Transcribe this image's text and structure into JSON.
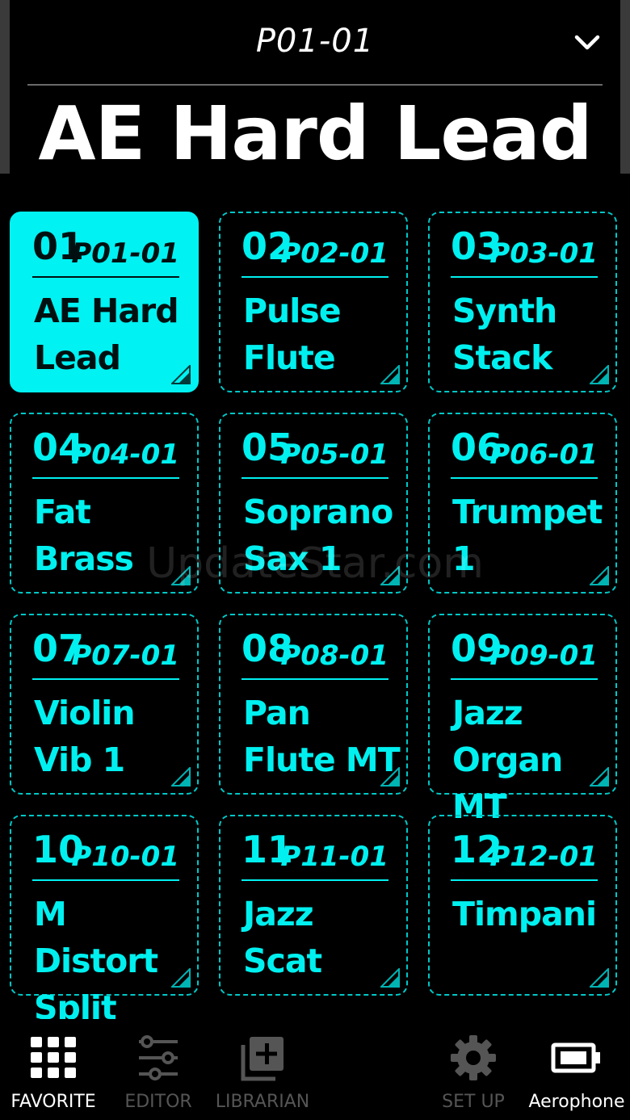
{
  "header": {
    "patch_code": "P01-01",
    "patch_name": "AE Hard Lead"
  },
  "tiles": [
    {
      "num": "01",
      "code": "P01-01",
      "name": "AE Hard Lead",
      "selected": true
    },
    {
      "num": "02",
      "code": "P02-01",
      "name": "Pulse Flute"
    },
    {
      "num": "03",
      "code": "P03-01",
      "name": "Synth Stack"
    },
    {
      "num": "04",
      "code": "P04-01",
      "name": "Fat Brass"
    },
    {
      "num": "05",
      "code": "P05-01",
      "name": "Soprano Sax 1"
    },
    {
      "num": "06",
      "code": "P06-01",
      "name": "Trumpet 1"
    },
    {
      "num": "07",
      "code": "P07-01",
      "name": "Violin Vib 1"
    },
    {
      "num": "08",
      "code": "P08-01",
      "name": "Pan Flute MT"
    },
    {
      "num": "09",
      "code": "P09-01",
      "name": "Jazz Organ MT"
    },
    {
      "num": "10",
      "code": "P10-01",
      "name": "M Distort Split"
    },
    {
      "num": "11",
      "code": "P11-01",
      "name": "Jazz Scat"
    },
    {
      "num": "12",
      "code": "P12-01",
      "name": "Timpani"
    }
  ],
  "watermark": "UpdateStar.com",
  "nav": {
    "favorite": "FAVORITE",
    "editor": "EDITOR",
    "librarian": "LIBRARIAN",
    "setup": "SET UP",
    "device": "Aerophone"
  },
  "colors": {
    "accent": "#00f2f2",
    "background": "#000000",
    "inactive": "#555555"
  },
  "icons": {
    "chevron": "chevron-down-icon",
    "favorite": "grid-icon",
    "editor": "sliders-icon",
    "librarian": "library-add-icon",
    "setup": "gear-icon",
    "device": "battery-icon"
  }
}
